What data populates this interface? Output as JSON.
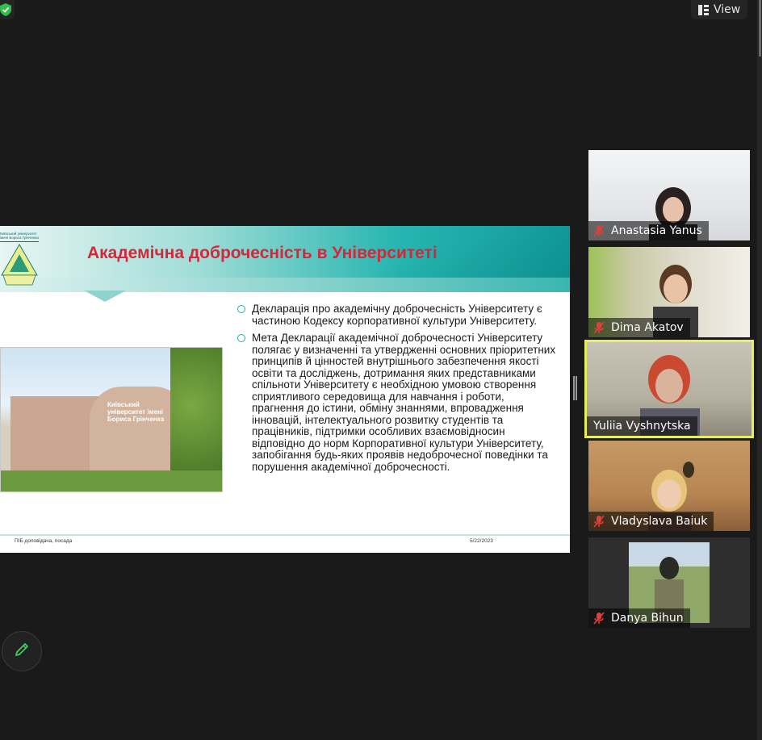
{
  "toolbar": {
    "view_label": "View"
  },
  "slide": {
    "title": "Академічна доброчесність в Університеті",
    "logo_text": "Київський університет імені Бориса Грінченка",
    "bullets": [
      "Декларація про академічну доброчесність Університету є частиною Кодексу корпоративної культури Університету.",
      "Мета Декларації академічної доброчесності Університету полягає у визначенні та утвердженні основних пріоритетних принципів й цінностей внутрішнього забезпечення якості освіти та досліджень, дотримання яких представниками спільноти Університету є необхідною умовою створення сприятливого середовища для навчання і роботи, прагнення до істини, обміну знаннями, впровадження інновацій, інтелектуального розвитку студентів та працівників, підтримки особливих взаємовідносин відповідно до норм Корпоративної культури Університету, запобігання будь-яких проявів недоброчесної поведінки та порушення академічної доброчесності."
    ],
    "building_sign": "Київський університет імені Бориса Грінченка",
    "footer_left": "ПІБ доповідача, посада",
    "footer_right": "5/22/2023"
  },
  "participants": [
    {
      "name": "Anastasia Yanus",
      "muted": true,
      "active": false,
      "bg": "#e9ecef"
    },
    {
      "name": "Dima Akatov",
      "muted": true,
      "active": false,
      "bg": "#c9c2a8"
    },
    {
      "name": "Yuliia Vyshnytska",
      "muted": false,
      "active": true,
      "bg": "#b9b2a3"
    },
    {
      "name": "Vladyslava Baiuk",
      "muted": true,
      "active": false,
      "bg": "#b88a56"
    },
    {
      "name": "Danya Bihun",
      "muted": true,
      "active": false,
      "bg": "#3b3b3b"
    }
  ],
  "colors": {
    "active_border": "#e6ee5c",
    "mic_muted": "#e0403a",
    "title_red": "#d6263a",
    "accent_teal": "#20b3a8"
  }
}
